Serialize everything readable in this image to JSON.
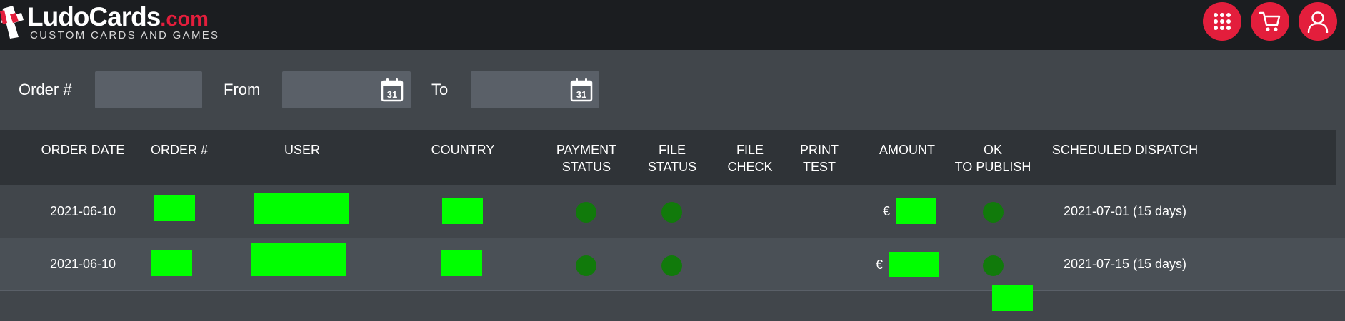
{
  "brand": {
    "name": "LudoCards",
    "domain": ".com",
    "tagline": "CUSTOM CARDS AND GAMES",
    "accent_color": "#e31e3c"
  },
  "top_actions": [
    {
      "icon": "grid-icon",
      "label": "apps"
    },
    {
      "icon": "cart-icon",
      "label": "cart"
    },
    {
      "icon": "user-icon",
      "label": "account"
    }
  ],
  "filters": {
    "order_label": "Order #",
    "order_value": "",
    "from_label": "From",
    "from_value": "",
    "to_label": "To",
    "to_value": "",
    "calendar_day": "31"
  },
  "table": {
    "columns": {
      "order_date": "ORDER DATE",
      "order_no": "ORDER  #",
      "user": "USER",
      "country": "COUNTRY",
      "payment_status_1": "PAYMENT",
      "payment_status_2": "STATUS",
      "file_status_1": "FILE",
      "file_status_2": "STATUS",
      "file_check_1": "FILE",
      "file_check_2": "CHECK",
      "print_test_1": "PRINT",
      "print_test_2": "TEST",
      "amount": "AMOUNT",
      "ok_publish_1": "OK",
      "ok_publish_2": "TO PUBLISH",
      "scheduled_dispatch": "SCHEDULED DISPATCH"
    },
    "rows": [
      {
        "order_date": "2021-06-10",
        "currency": "€",
        "payment_status": "ok",
        "file_status": "ok",
        "ok_to_publish": "ok",
        "scheduled_dispatch": "2021-07-01 (15 days)"
      },
      {
        "order_date": "2021-06-10",
        "currency": "€",
        "payment_status": "ok",
        "file_status": "ok",
        "ok_to_publish": "ok",
        "scheduled_dispatch": "2021-07-15 (15 days)"
      }
    ],
    "status_color": "#117a0b",
    "redaction_color": "#00ff00"
  }
}
